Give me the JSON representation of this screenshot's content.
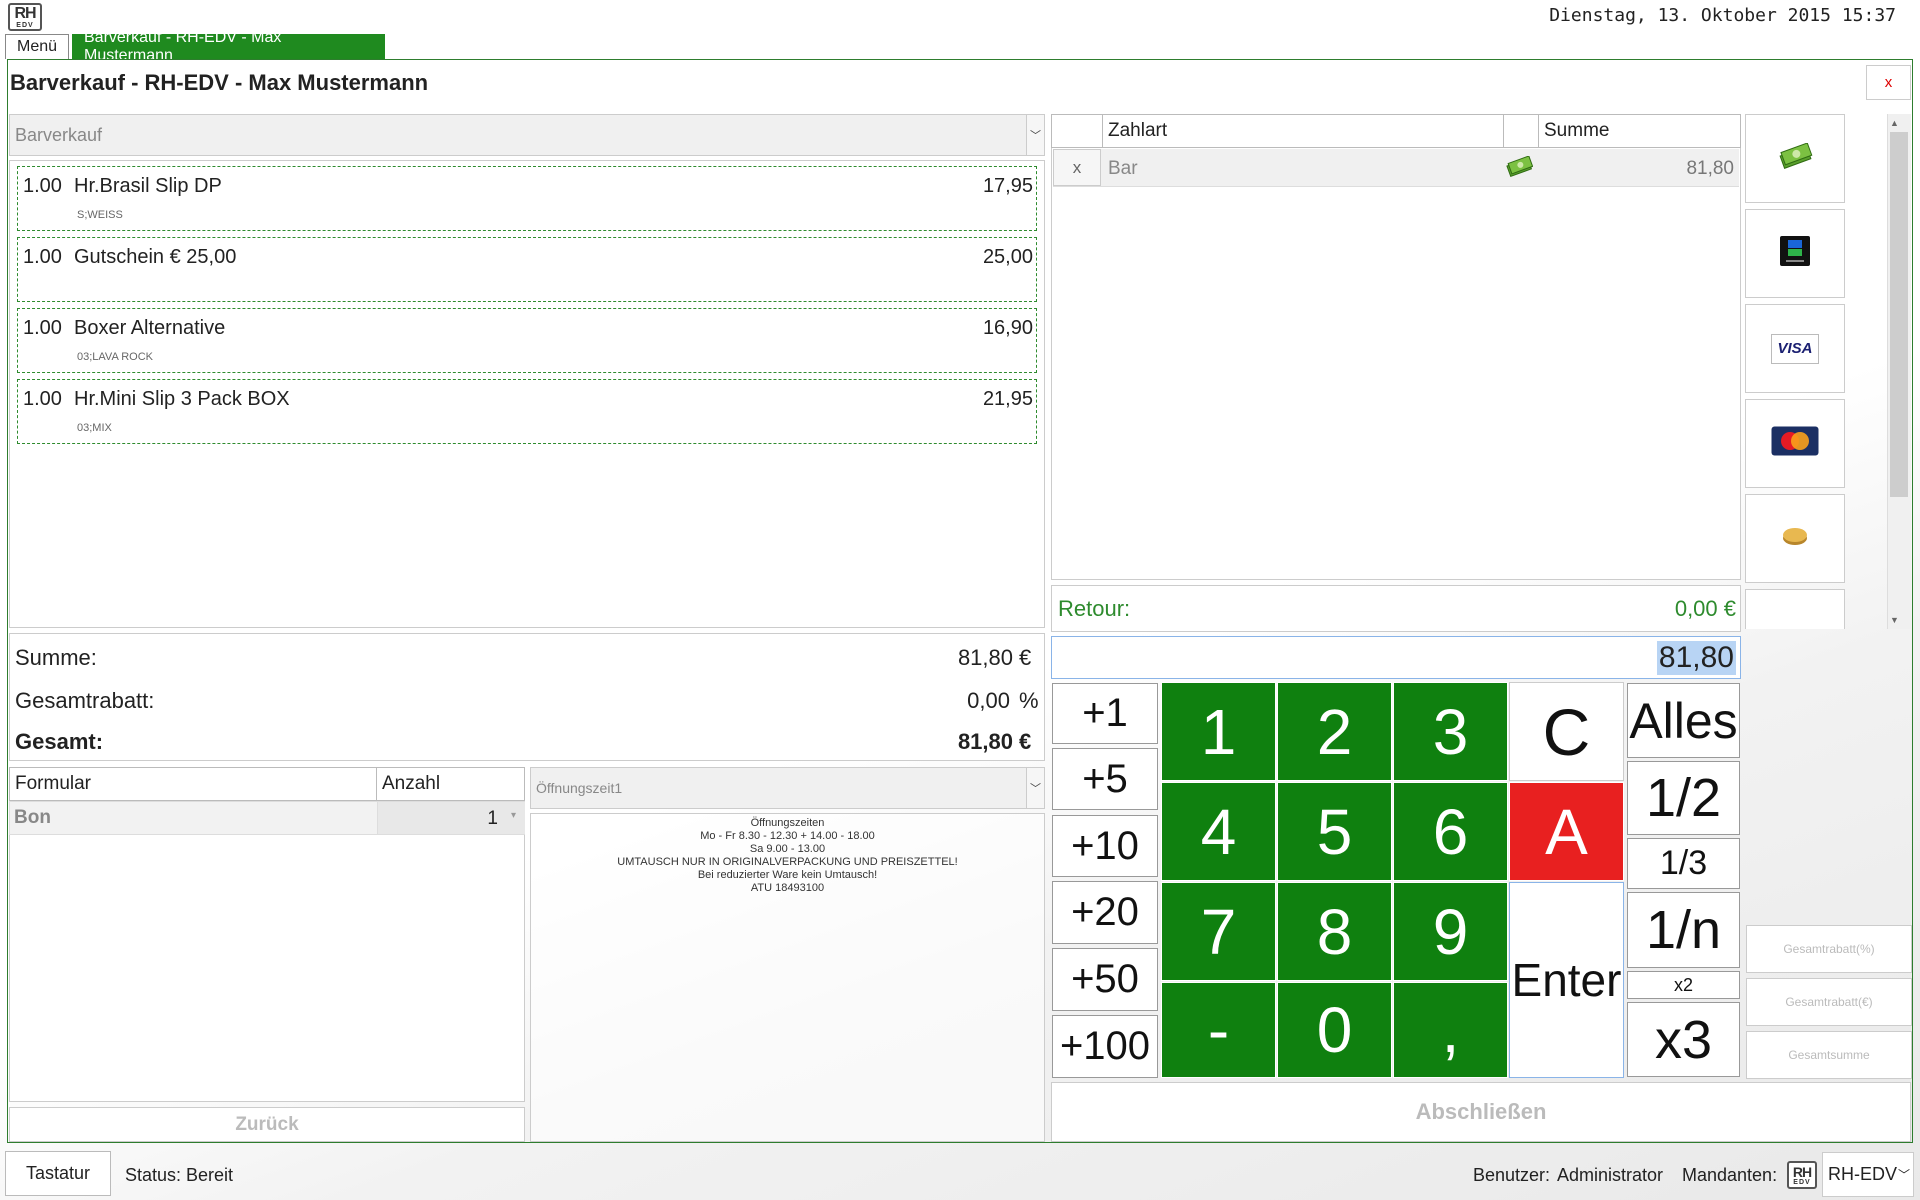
{
  "header": {
    "logo_top": "RH",
    "logo_bottom": "EDV",
    "datetime": "Dienstag, 13. Oktober 2015 15:37"
  },
  "tabs": [
    {
      "label": "Menü"
    },
    {
      "label": "Barverkauf - RH-EDV - Max  Mustermann"
    }
  ],
  "window": {
    "title": "Barverkauf - RH-EDV - Max  Mustermann",
    "close_label": "x"
  },
  "sale": {
    "type_select": "Barverkauf",
    "items": [
      {
        "qty": "1.00",
        "name": "Hr.Brasil Slip DP",
        "price": "17,95",
        "variant": "S;WEISS"
      },
      {
        "qty": "1.00",
        "name": "Gutschein € 25,00",
        "price": "25,00",
        "variant": ""
      },
      {
        "qty": "1.00",
        "name": "Boxer Alternative",
        "price": "16,90",
        "variant": "03;LAVA ROCK"
      },
      {
        "qty": "1.00",
        "name": "Hr.Mini Slip 3 Pack BOX",
        "price": "21,95",
        "variant": "03;MIX"
      }
    ]
  },
  "totals": {
    "summe_label": "Summe:",
    "summe_value": "81,80",
    "summe_unit": "€",
    "rabatt_label": "Gesamtrabatt:",
    "rabatt_value": "0,00",
    "rabatt_unit": "%",
    "gesamt_label": "Gesamt:",
    "gesamt_value": "81,80",
    "gesamt_unit": "€"
  },
  "forms": {
    "col_formular": "Formular",
    "col_anzahl": "Anzahl",
    "row_name": "Bon",
    "row_count": "1",
    "back_label": "Zurück"
  },
  "receipt": {
    "select": "Öffnungszeit1",
    "lines": [
      "Öffnungszeiten",
      "Mo - Fr 8.30 - 12.30 + 14.00 - 18.00",
      "Sa 9.00 - 13.00",
      "UMTAUSCH NUR IN ORIGINALVERPACKUNG UND PREISZETTEL!",
      "Bei reduzierter Ware kein Umtausch!",
      "ATU 18493100"
    ]
  },
  "payments": {
    "col_zahlart": "Zahlart",
    "col_summe": "Summe",
    "rows": [
      {
        "remove": "x",
        "method": "Bar",
        "amount": "81,80"
      }
    ],
    "retour_label": "Retour:",
    "retour_value": "0,00 €",
    "input_value": "81,80"
  },
  "payment_methods": [
    {
      "icon": "cash-icon"
    },
    {
      "icon": "bankomat-card-icon"
    },
    {
      "icon": "visa-card-icon"
    },
    {
      "icon": "mastercard-icon"
    },
    {
      "icon": "coin-icon"
    }
  ],
  "visa_text": "VISA",
  "keypad": {
    "plus": [
      "+1",
      "+5",
      "+10",
      "+20",
      "+50",
      "+100"
    ],
    "digits": [
      "1",
      "2",
      "3",
      "4",
      "5",
      "6",
      "7",
      "8",
      "9",
      "-",
      "0",
      ","
    ],
    "clear": "C",
    "a": "A",
    "enter": "Enter",
    "alles": "Alles",
    "half": "1/2",
    "third": "1/3",
    "nth": "1/n",
    "x2": "x2",
    "x3": "x3"
  },
  "side_actions": [
    "Gesamtrabatt(%)",
    "Gesamtrabatt(€)",
    "Gesamtsumme"
  ],
  "finish_label": "Abschließen",
  "statusbar": {
    "keyboard": "Tastatur",
    "status": "Status: Bereit",
    "user_label": "Benutzer:",
    "user": "Administrator",
    "client_label": "Mandanten:",
    "client": "RH-EDV"
  },
  "colors": {
    "accent": "#0f800f",
    "danger": "#e82020",
    "retour": "#2e8b2e"
  }
}
